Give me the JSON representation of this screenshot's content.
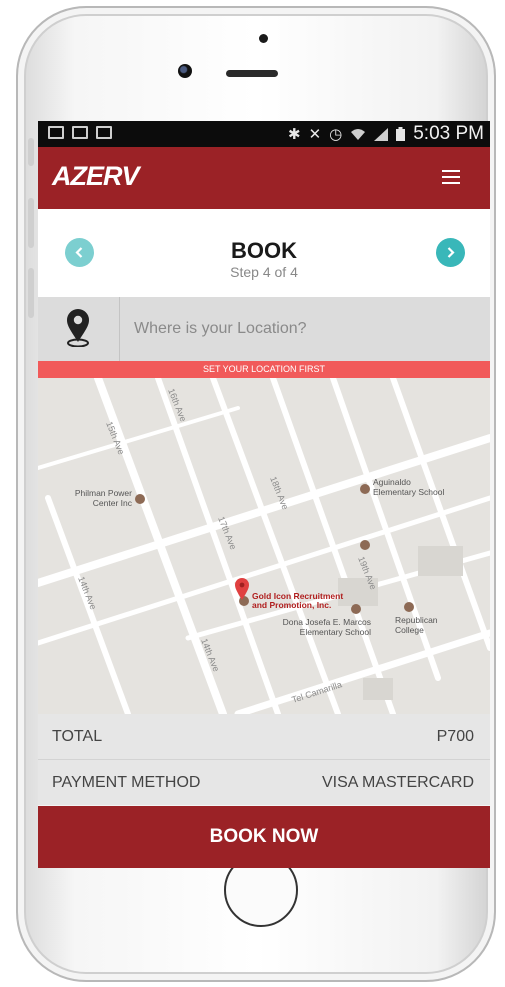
{
  "status_bar": {
    "time": "5:03 PM",
    "left_icons": [
      "image-icon",
      "mail-icon",
      "mail-icon"
    ],
    "right_icons": [
      "bluetooth-icon",
      "mute-icon",
      "alarm-icon",
      "wifi-icon",
      "signal-icon",
      "battery-icon"
    ]
  },
  "app_bar": {
    "brand": "AZERV",
    "menu_icon": "hamburger-icon",
    "color": "#9b2226"
  },
  "stepper": {
    "title": "BOOK",
    "step": "Step 4 of 4",
    "prev_icon": "chevron-left-icon",
    "next_icon": "chevron-right-icon",
    "accent": "#39b7b9"
  },
  "location": {
    "icon": "map-pin-icon",
    "placeholder": "Where is your Location?",
    "warning": "SET YOUR LOCATION FIRST",
    "warning_color": "#f15a5a"
  },
  "map": {
    "street_labels": [
      "15th Ave",
      "14th Ave",
      "16th Ave",
      "17th Ave",
      "18th Ave",
      "19th Ave",
      "14th Ave",
      "Tel Camarilla"
    ],
    "places": [
      {
        "name_line1": "Philman Power",
        "name_line2": "Center Inc"
      },
      {
        "name_line1": "Aguinaldo",
        "name_line2": "Elementary School"
      },
      {
        "name_line1": "Dona Josefa E. Marcos",
        "name_line2": "Elementary School"
      },
      {
        "name_line1": "Republican",
        "name_line2": "College"
      }
    ],
    "selected_place": {
      "name_line1": "Gold Icon Recruitment",
      "name_line2": "and Promotion, Inc."
    }
  },
  "summary": {
    "total_label": "TOTAL",
    "total_value": "P700",
    "payment_label": "PAYMENT METHOD",
    "payment_value": "VISA MASTERCARD"
  },
  "cta": {
    "label": "BOOK NOW"
  }
}
